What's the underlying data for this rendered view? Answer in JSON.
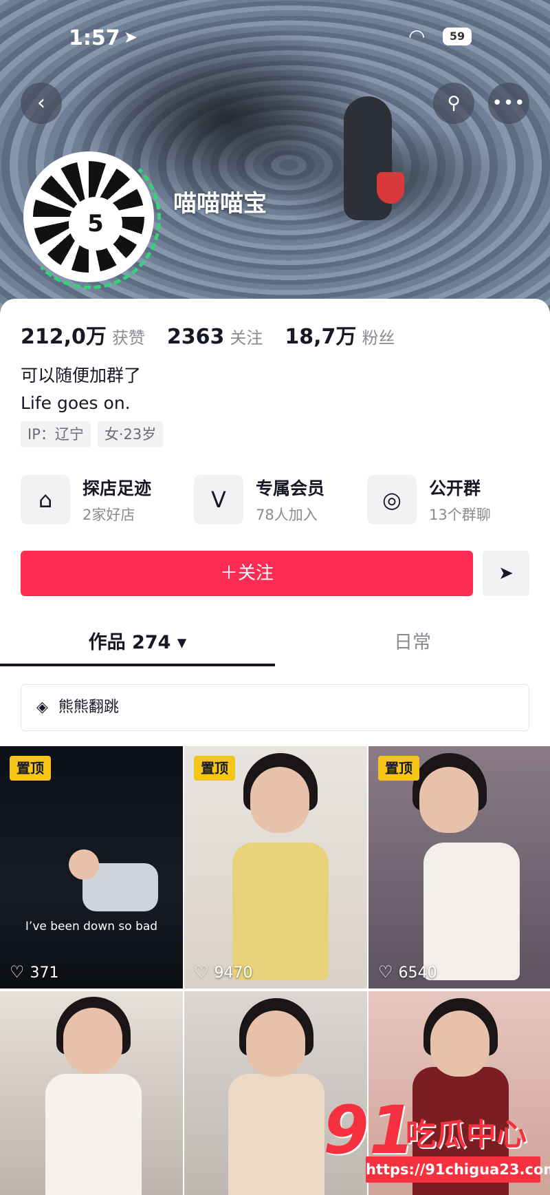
{
  "status_bar": {
    "time": "1:57",
    "battery": "59"
  },
  "profile": {
    "nickname": "喵喵喵宝",
    "avatar_text": "5"
  },
  "stats": [
    {
      "num": "212,0万",
      "label": "获赞"
    },
    {
      "num": "2363",
      "label": "关注"
    },
    {
      "num": "18,7万",
      "label": "粉丝"
    }
  ],
  "bio": {
    "line1": "可以随便加群了",
    "line2": "Life goes on."
  },
  "tags": {
    "ip": "IP：辽宁",
    "gender_age": "女·23岁"
  },
  "features": [
    {
      "title": "探店足迹",
      "sub": "2家好店",
      "icon": "shop-icon"
    },
    {
      "title": "专属会员",
      "sub": "78人加入",
      "icon": "v-member-icon"
    },
    {
      "title": "公开群",
      "sub": "13个群聊",
      "icon": "chat-group-icon"
    }
  ],
  "follow_label": "＋关注",
  "tabs": {
    "works": "作品 274 ▾",
    "daily": "日常"
  },
  "collection": "熊熊翻跳",
  "videos": [
    {
      "pinned": "置顶",
      "likes": "371",
      "caption": "I’ve been down so bad"
    },
    {
      "pinned": "置顶",
      "likes": "9470"
    },
    {
      "pinned": "置顶",
      "likes": "6540"
    },
    {},
    {},
    {}
  ],
  "watermark": {
    "logo": "91",
    "text": "吃瓜中心",
    "url": "https://91chigua23.com"
  },
  "colors": {
    "accent": "#fe2c55",
    "pin": "#f5c518",
    "watermark": "#f5303f"
  }
}
